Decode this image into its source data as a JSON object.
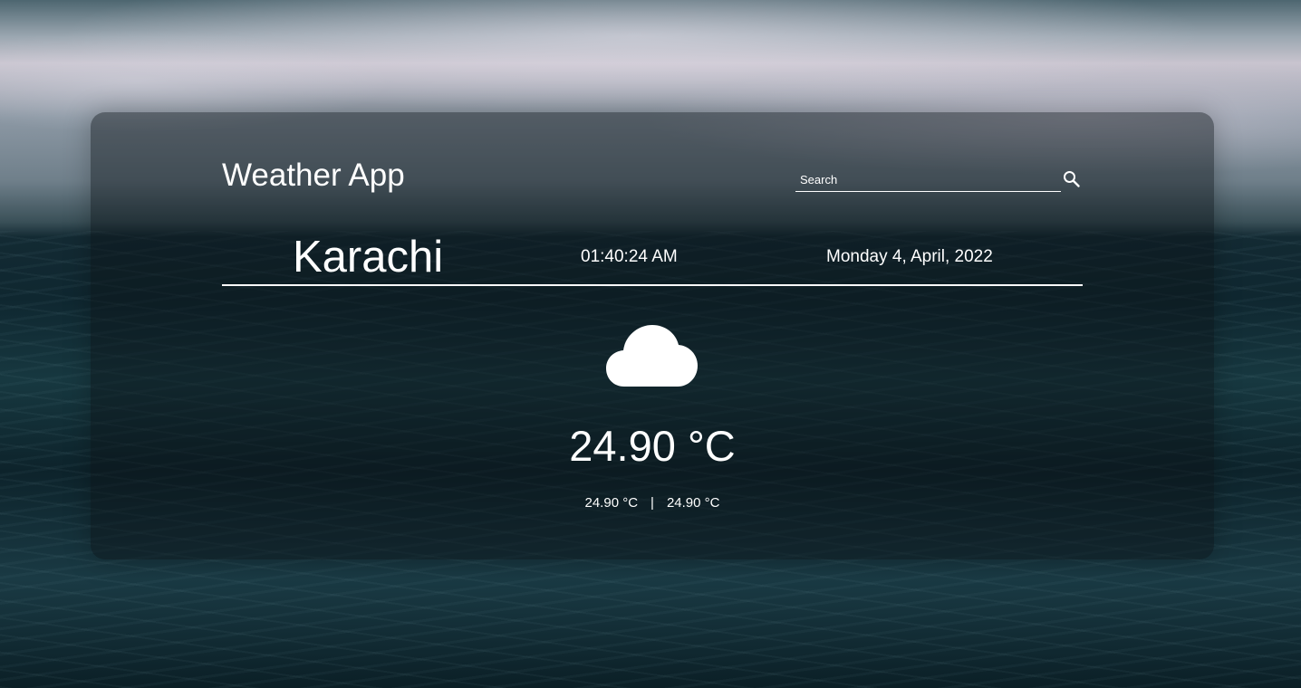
{
  "app": {
    "title": "Weather App"
  },
  "search": {
    "placeholder": "Search",
    "icon": "search-icon"
  },
  "location": {
    "city": "Karachi",
    "time": "01:40:24 AM",
    "date": "Monday 4, April, 2022"
  },
  "weather": {
    "icon": "cloud-icon",
    "temperature": "24.90 °C",
    "min_temp": "24.90 °C",
    "separator": "|",
    "max_temp": "24.90 °C"
  },
  "colors": {
    "text": "#ffffff",
    "card_overlay": "rgba(10, 18, 22, 0.45)"
  }
}
